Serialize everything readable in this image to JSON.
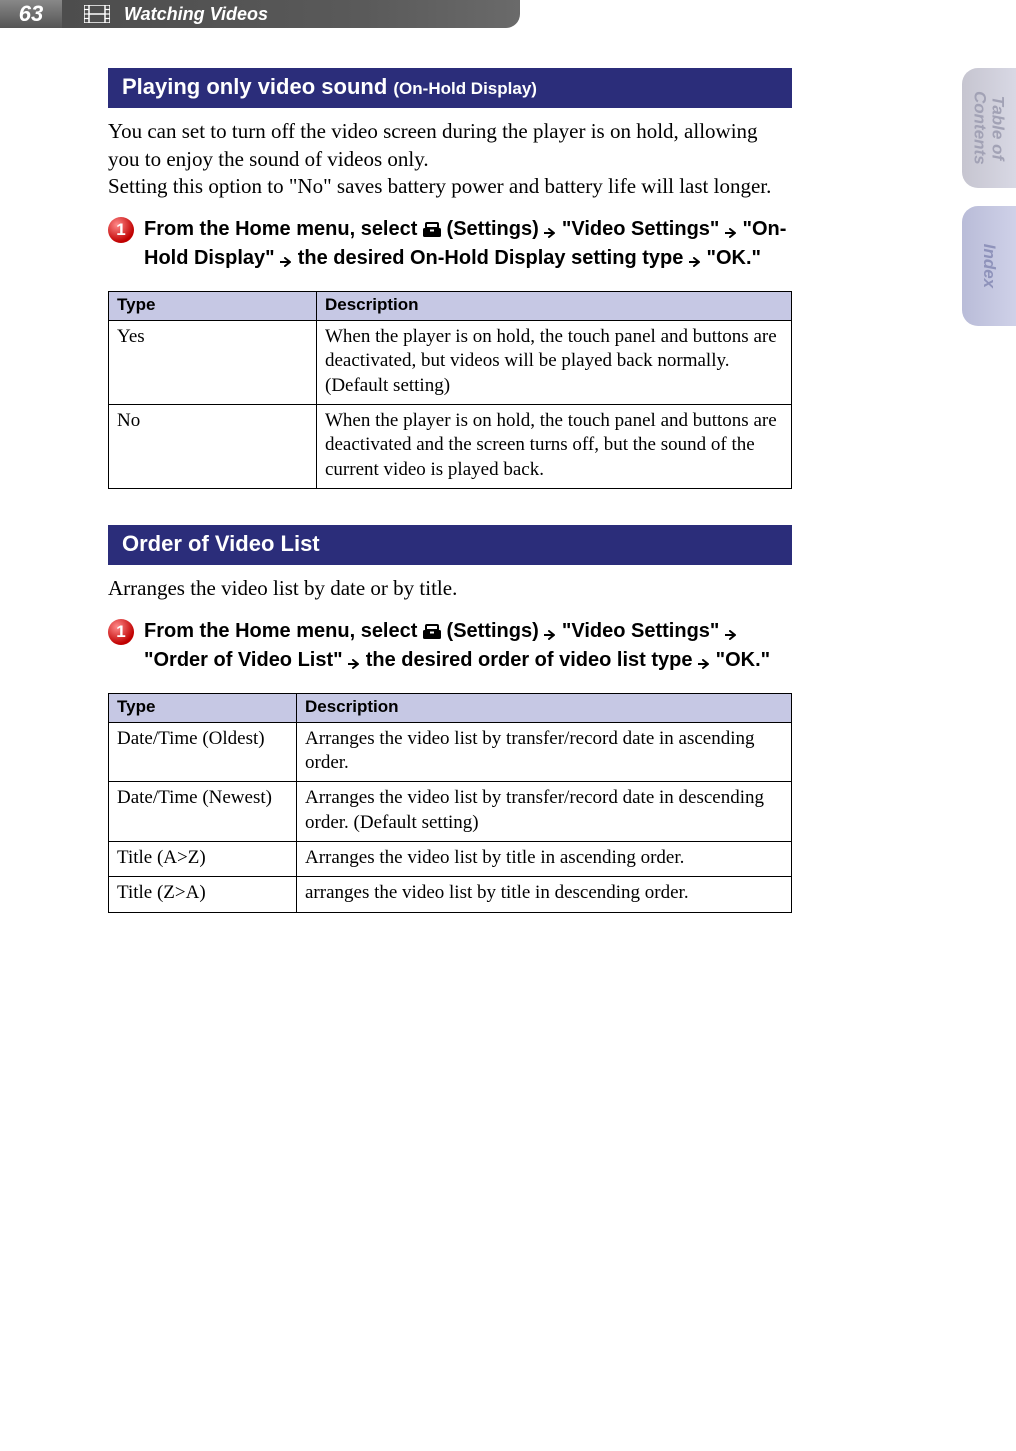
{
  "header": {
    "page_number": "63",
    "chapter_title": "Watching Videos"
  },
  "side_tabs": {
    "toc_line1": "Table of",
    "toc_line2": "Contents",
    "index": "Index"
  },
  "section1": {
    "heading_main": "Playing only video sound",
    "heading_sub": "(On-Hold Display)",
    "intro": "You can set to turn off the video screen during the player is on hold, allowing you to enjoy the sound of videos only.\nSetting this option to \"No\" saves battery power and battery life will last longer.",
    "step": {
      "number": "1",
      "t1": "From the Home menu, select ",
      "t2": " (Settings) ",
      "t3": " \"Video Settings\" ",
      "t4": " \"On-Hold Display\" ",
      "t5": " the desired On-Hold Display setting type ",
      "t6": " \"OK.\""
    },
    "table": {
      "col_type": "Type",
      "col_desc": "Description",
      "rows": [
        {
          "type": "Yes",
          "desc": "When the player is on hold, the touch panel and buttons are deactivated, but videos will be played back normally. (Default setting)"
        },
        {
          "type": "No",
          "desc": "When the player is on hold, the touch panel and buttons are deactivated and the screen turns off, but the sound of the current video is played back."
        }
      ]
    }
  },
  "section2": {
    "heading_main": "Order of Video List",
    "intro": "Arranges the video list by date or by title.",
    "step": {
      "number": "1",
      "t1": "From the Home menu, select ",
      "t2": " (Settings) ",
      "t3": " \"Video Settings\" ",
      "t4": " \"Order of Video List\" ",
      "t5": " the desired order of video list type ",
      "t6": " \"OK.\""
    },
    "table": {
      "col_type": "Type",
      "col_desc": "Description",
      "rows": [
        {
          "type": "Date/Time (Oldest)",
          "desc": "Arranges the video list by transfer/record date in ascending order."
        },
        {
          "type": "Date/Time (Newest)",
          "desc": "Arranges the video list by transfer/record date in descending order. (Default setting)"
        },
        {
          "type": "Title (A>Z)",
          "desc": "Arranges the video list by title in ascending order."
        },
        {
          "type": "Title (Z>A)",
          "desc": "arranges the video list by title in descending order."
        }
      ]
    }
  }
}
